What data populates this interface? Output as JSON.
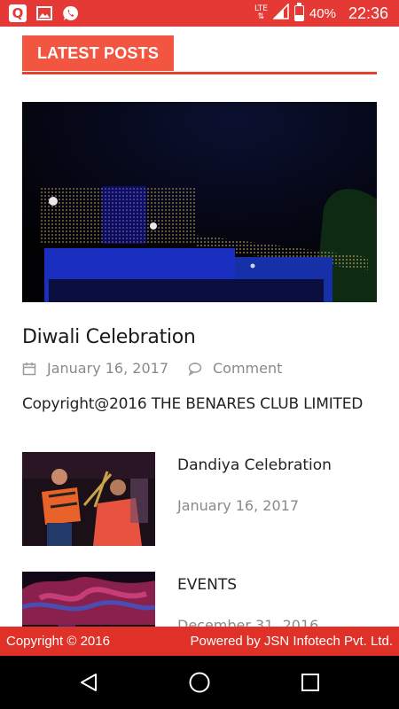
{
  "status_bar": {
    "network_label": "LTE",
    "battery": "40%",
    "battery_level": 0.4,
    "time": "22:36",
    "icons": [
      "q-app-icon",
      "image-icon",
      "whatsapp-icon",
      "lte-signal-icon",
      "signal-icon",
      "battery-icon"
    ]
  },
  "section": {
    "title": "LATEST POSTS"
  },
  "featured_post": {
    "title": "Diwali Celebration",
    "date": "January 16, 2017",
    "comment_label": "Comment",
    "excerpt": "Copyright@2016 THE BENARES CLUB LIMITED"
  },
  "posts": [
    {
      "title": "Dandiya Celebration",
      "date": "January 16, 2017"
    },
    {
      "title": "EVENTS",
      "date": "December 31, 2016"
    }
  ],
  "footer": {
    "copyright": "Copyright © 2016",
    "powered_by": "Powered by JSN Infotech Pvt. Ltd."
  },
  "colors": {
    "accent": "#e53935",
    "tab": "#f35640",
    "footer": "#df3127",
    "muted_text": "#8a8a8a"
  },
  "nav_bar": {
    "icons": [
      "back-icon",
      "home-icon",
      "recents-icon"
    ]
  }
}
